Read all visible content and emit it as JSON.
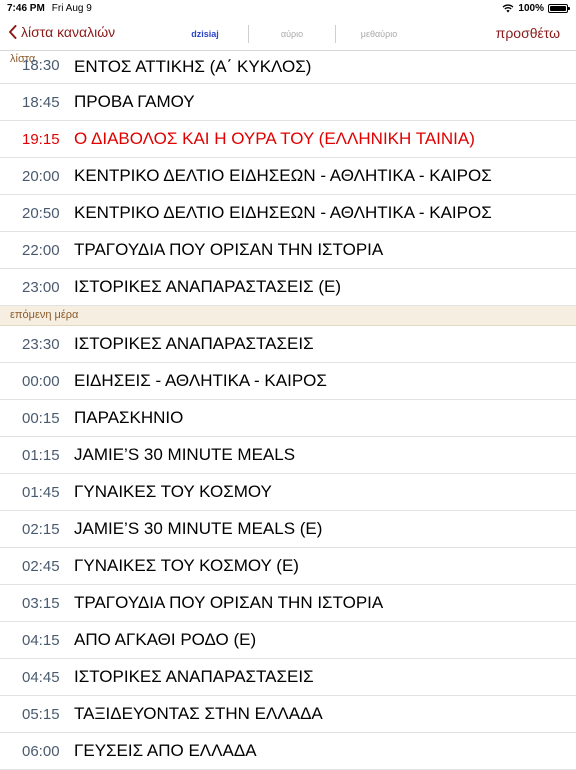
{
  "status": {
    "time": "7:46 PM",
    "date": "Fri Aug 9",
    "battery": "100%"
  },
  "nav": {
    "back_label": "λίστα καναλιών",
    "add_label": "προσθέτω",
    "tabs": [
      "dzisiaj",
      "αύριο",
      "μεθαύριο"
    ],
    "overlay_label": "λίστα"
  },
  "programs_today": [
    {
      "time": "18:30",
      "title": "ΕΝΤΟΣ ΑΤΤΙΚΗΣ (Α΄ ΚΥΚΛΟΣ)"
    },
    {
      "time": "18:45",
      "title": "ΠΡΟΒΑ ΓΑΜΟΥ"
    },
    {
      "time": "19:15",
      "title": "Ο ΔΙΑΒΟΛΟΣ ΚΑΙ Η ΟΥΡΑ ΤΟΥ (ΕΛΛΗΝΙΚΗ ΤΑΙΝΙΑ)"
    },
    {
      "time": "20:00",
      "title": "ΚΕΝΤΡΙΚΟ ΔΕΛΤΙΟ ΕΙΔΗΣΕΩΝ - ΑΘΛΗΤΙΚΑ - ΚΑΙΡΟΣ"
    },
    {
      "time": "20:50",
      "title": "ΚΕΝΤΡΙΚΟ ΔΕΛΤΙΟ ΕΙΔΗΣΕΩΝ - ΑΘΛΗΤΙΚΑ - ΚΑΙΡΟΣ"
    },
    {
      "time": "22:00",
      "title": "ΤΡΑΓΟΥΔΙΑ ΠΟΥ ΟΡΙΣΑΝ ΤΗΝ ΙΣΤΟΡΙΑ"
    },
    {
      "time": "23:00",
      "title": "ΙΣΤΟΡΙΚΕΣ ΑΝΑΠΑΡΑΣΤΑΣΕΙΣ   (Ε)"
    }
  ],
  "next_day_header": "επόμενη μέρα",
  "programs_next": [
    {
      "time": "23:30",
      "title": "ΙΣΤΟΡΙΚΕΣ ΑΝΑΠΑΡΑΣΤΑΣΕΙΣ"
    },
    {
      "time": "00:00",
      "title": "ΕΙΔΗΣΕΙΣ - ΑΘΛΗΤΙΚΑ - ΚΑΙΡΟΣ"
    },
    {
      "time": "00:15",
      "title": "ΠΑΡΑΣΚΗΝΙΟ"
    },
    {
      "time": "01:15",
      "title": "JAMIE’S 30 MINUTE MEALS"
    },
    {
      "time": "01:45",
      "title": "ΓΥΝΑΙΚΕΣ ΤΟΥ ΚΟΣΜΟΥ"
    },
    {
      "time": "02:15",
      "title": "JAMIE’S 30 MINUTE MEALS (Ε)"
    },
    {
      "time": "02:45",
      "title": "ΓΥΝΑΙΚΕΣ ΤΟΥ ΚΟΣΜΟΥ (Ε)"
    },
    {
      "time": "03:15",
      "title": "ΤΡΑΓΟΥΔΙΑ ΠΟΥ ΟΡΙΣΑΝ ΤΗΝ ΙΣΤΟΡΙΑ"
    },
    {
      "time": "04:15",
      "title": "ΑΠΟ ΑΓΚΑΘΙ ΡΟΔΟ   (Ε)"
    },
    {
      "time": "04:45",
      "title": "ΙΣΤΟΡΙΚΕΣ ΑΝΑΠΑΡΑΣΤΑΣΕΙΣ"
    },
    {
      "time": "05:15",
      "title": "ΤΑΞΙΔΕΥΟΝΤΑΣ ΣΤΗΝ ΕΛΛΑΔΑ"
    },
    {
      "time": "06:00",
      "title": "ΓΕΥΣΕΙΣ ΑΠΟ ΕΛΛΑΔΑ"
    }
  ],
  "colors": {
    "accent": "#8b1a1a",
    "active_tab": "#2b44c6",
    "highlight": "#e00000",
    "section_bg": "#f6efe1"
  },
  "icons": [
    "wifi-icon",
    "battery-icon",
    "chevron-left-icon"
  ]
}
